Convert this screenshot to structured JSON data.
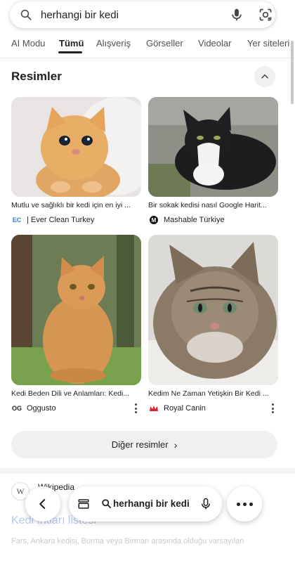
{
  "search": {
    "query": "herhangi bir kedi"
  },
  "tabs": [
    {
      "label": "AI Modu",
      "active": false
    },
    {
      "label": "Tümü",
      "active": true
    },
    {
      "label": "Alışveriş",
      "active": false
    },
    {
      "label": "Görseller",
      "active": false
    },
    {
      "label": "Videolar",
      "active": false
    },
    {
      "label": "Yer siteleri",
      "active": false
    }
  ],
  "images_section": {
    "title": "Resimler",
    "cards": [
      {
        "caption": "Mutlu ve sağlıklı bir kedi için en iyi ...",
        "source": "| Ever Clean Turkey",
        "favicon": "ever-clean-icon"
      },
      {
        "caption": "Bir sokak kedisi nasıl Google Harit...",
        "source": "Mashable Türkiye",
        "favicon": "mashable-icon"
      },
      {
        "caption": "Kedi Beden Dili ve Anlamları: Kedi...",
        "source": "Oggusto",
        "favicon": "oggusto-icon"
      },
      {
        "caption": "Kedim Ne Zaman Yetişkin Bir Kedi ...",
        "source": "Royal Canin",
        "favicon": "royal-canin-icon"
      }
    ],
    "more_label": "Diğer resimler"
  },
  "wiki_result": {
    "site": "Wikipedia",
    "logo_letter": "W",
    "link_title": "Kedi ırkları listesi",
    "snippet": "Fars, Ankara kedisi, Burma veya Birman arasında olduğu varsayılan"
  },
  "bottom_bar": {
    "query": "herhangi bir kedi"
  },
  "colors": {
    "accent": "#1f1f1f",
    "link": "#1a0dab",
    "pill_bg": "#eef0f2"
  }
}
